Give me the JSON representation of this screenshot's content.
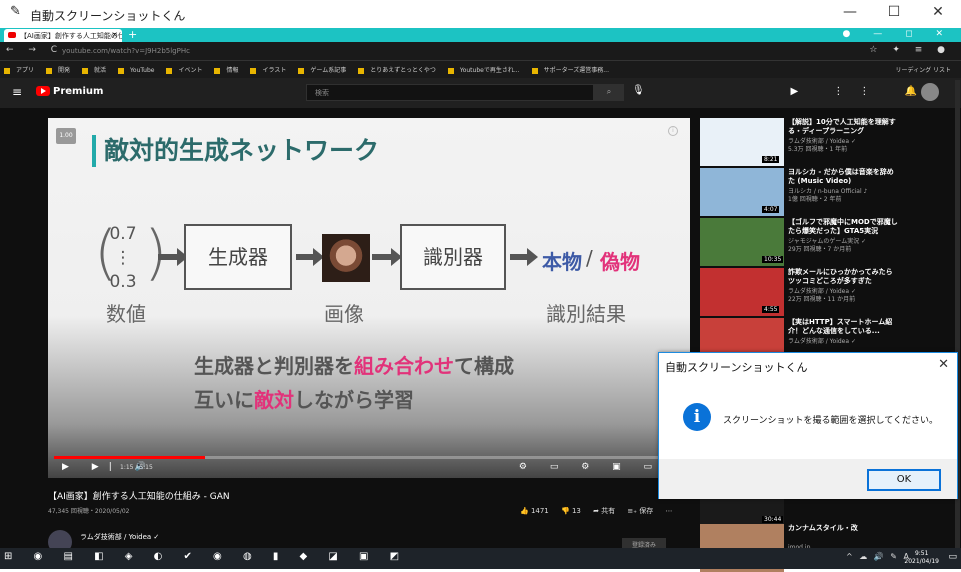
{
  "app": {
    "title": "自動スクリーンショットくん",
    "pen_icon": "pen-icon"
  },
  "window_controls": {
    "minimize": "—",
    "maximize": "☐",
    "close": "✕"
  },
  "browser": {
    "tab_title": "【AI画家】創作する人工知能の仕組み",
    "tab_close": "×",
    "new_tab": "+",
    "tabstrip_right": "● — ◻ ✕",
    "nav": "← → C",
    "url": "youtube.com/watch?v=J9H2b5lgPHc",
    "toolbar_right": "☆ ✦ ≡ ●",
    "bookmarks": [
      "アプリ",
      "開発",
      "就活",
      "YouTube",
      "イベント",
      "情報",
      "イラスト",
      "ゲーム系記事",
      "とりあえずとっとくやつ",
      "Youtubeで再生され...",
      "サポーターズ運営事務..."
    ],
    "reading_list": "リーディング リスト"
  },
  "youtube": {
    "menu": "≡",
    "logo": "Premium",
    "search_placeholder": "検索",
    "search_btn": "⌕",
    "mic": "🎙",
    "right_icons": "▶ ⋮⋮ 🔔"
  },
  "slide": {
    "badge": "1.00",
    "info": "i",
    "title": "敵対的生成ネットワーク",
    "vector": [
      "0.7",
      "⋮",
      "0.3"
    ],
    "generator": "生成器",
    "discriminator": "識別器",
    "real": "本物",
    "slash": "/",
    "fake": "偽物",
    "label_number": "数値",
    "label_image": "画像",
    "label_result": "識別結果",
    "line1_a": "生成器と判別器を",
    "line1_b": "組み合わせ",
    "line1_c": "て構成",
    "line2_a": "互いに",
    "line2_b": "敵対",
    "line2_c": "しながら学習"
  },
  "player": {
    "progress": 0.24,
    "controls_left": "▶ ▶| 🔊",
    "time": "1:15 / 5:15",
    "controls_right": "⚙ ▭ ⚙ ▣ ▭"
  },
  "meta": {
    "title": "【AI画家】創作する人工知能の仕組み - GAN",
    "views": "47,345 回視聴・2020/05/02",
    "likes": "👍 1471",
    "dislikes": "👎 13",
    "share": "➦ 共有",
    "save": "≡₊ 保存",
    "more": "⋯",
    "channel": "ラムダ技術部 / Yoidea ✓",
    "subscribed": "登録済み"
  },
  "sidebar": [
    {
      "title": "【解説】10分で人工知能を理解する・ディープラーニング",
      "channel": "ラムダ技術部 / Yoidea ✓",
      "stats": "5.3万 回視聴・1 年前",
      "dur": "8:21",
      "color": "#e9f1f8"
    },
    {
      "title": "ヨルシカ - だから僕は音楽を辞めた (Music Video)",
      "channel": "ヨルシカ / n-buna Official ♪",
      "stats": "1億 回視聴・2 年前",
      "dur": "4:07",
      "color": "#8fb6d8"
    },
    {
      "title": "【ゴルフで邪魔中にMODで邪魔したら爆笑だった】GTA5実況",
      "channel": "ジャモジャムのゲーム実況 ✓",
      "stats": "29万 回視聴・7 か月前",
      "dur": "10:35",
      "color": "#4a7a3a"
    },
    {
      "title": "詐欺メールにひっかかってみたらツッコミどころが多すぎた",
      "channel": "ラムダ技術部 / Yoidea ✓",
      "stats": "22万 回視聴・11 か月前",
      "dur": "4:55",
      "color": "#c23030"
    },
    {
      "title": "【実はHTTP】スマートホーム紹介！どんな通信をしている...",
      "channel": "ラムダ技術部 / Yoidea ✓",
      "stats": "",
      "dur": "",
      "color": "#c8403a"
    },
    {
      "title": "",
      "channel": "32万 回視聴・4 か月前",
      "stats": "",
      "dur": "30:44",
      "color": "#1a1a1a"
    },
    {
      "title": "カンナムスタイル・改",
      "channel": "imod.jp",
      "stats": "",
      "dur": "",
      "color": "#b08060"
    }
  ],
  "dialog": {
    "title": "自動スクリーンショットくん",
    "close": "✕",
    "icon": "i",
    "message": "スクリーンショットを撮る範囲を選択してください。",
    "ok": "OK"
  },
  "taskbar": {
    "icons": "⊞ ◉ ▤ ◧ ◈ ◐ ✔ ◉ ◍ ▮ ◆ ◪ ▣ ◩",
    "tray": "^ ☁ 🔊 ✎ A",
    "time": "9:51",
    "date": "2021/04/19",
    "notification": "▭"
  }
}
